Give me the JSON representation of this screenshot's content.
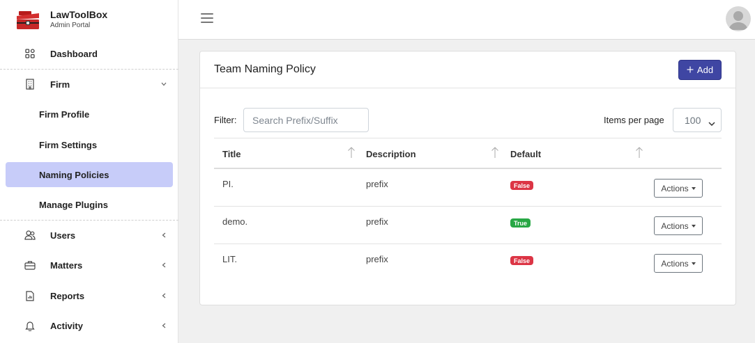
{
  "brand": {
    "title": "LawToolBox",
    "subtitle": "Admin Portal",
    "accent": "#d32f2f"
  },
  "sidebar": {
    "items": [
      {
        "label": "Dashboard",
        "icon": "grid-icon"
      },
      {
        "label": "Firm",
        "icon": "building-icon",
        "expanded": true
      },
      {
        "label": "Users",
        "icon": "users-icon"
      },
      {
        "label": "Matters",
        "icon": "briefcase-icon"
      },
      {
        "label": "Reports",
        "icon": "report-icon"
      },
      {
        "label": "Activity",
        "icon": "bell-icon"
      }
    ],
    "sub_items": [
      {
        "label": "Firm Profile"
      },
      {
        "label": "Firm Settings"
      },
      {
        "label": "Naming Policies",
        "active": true
      },
      {
        "label": "Manage Plugins"
      }
    ],
    "active_color": "#c7ccf9"
  },
  "card": {
    "title": "Team Naming Policy",
    "add_label": "Add",
    "add_color": "#3f46a3"
  },
  "filter": {
    "label": "Filter:",
    "placeholder": "Search Prefix/Suffix"
  },
  "pagination": {
    "label": "Items per page",
    "value": "100"
  },
  "table": {
    "columns": [
      "Title",
      "Description",
      "Default"
    ],
    "rows": [
      {
        "title": "PI.",
        "description": "prefix",
        "default": "False"
      },
      {
        "title": "demo.",
        "description": "prefix",
        "default": "True"
      },
      {
        "title": "LIT.",
        "description": "prefix",
        "default": "False"
      }
    ],
    "actions_label": "Actions",
    "false_color": "#dc3545",
    "true_color": "#28a745"
  }
}
